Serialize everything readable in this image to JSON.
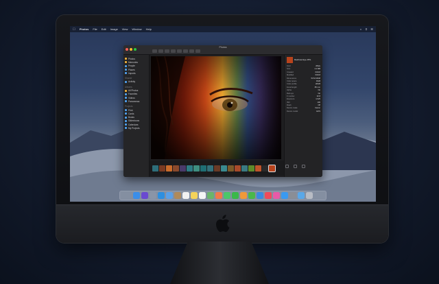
{
  "menubar": {
    "app": "Photos",
    "menus": [
      "File",
      "Edit",
      "Image",
      "View",
      "Window",
      "Help"
    ]
  },
  "window": {
    "title": "Photos"
  },
  "sidebar": {
    "items": [
      {
        "label": "Photos",
        "color": "#f0b23c"
      },
      {
        "label": "Memories",
        "color": "#f0b23c"
      },
      {
        "label": "People",
        "color": "#4ea0f0"
      },
      {
        "label": "Places",
        "color": "#4ea0f0"
      },
      {
        "label": "Imports",
        "color": "#4ea0f0"
      },
      {
        "label": "Shared",
        "section": true
      },
      {
        "label": "Activity",
        "color": "#4ea0f0"
      },
      {
        "label": "Albums",
        "section": true
      },
      {
        "label": "All Photos",
        "color": "#f0b23c"
      },
      {
        "label": "Favorites",
        "color": "#4ea0f0"
      },
      {
        "label": "Videos",
        "color": "#4ea0f0"
      },
      {
        "label": "Panoramas",
        "color": "#4ea0f0"
      },
      {
        "label": "Projects",
        "section": true
      },
      {
        "label": "Print",
        "color": "#4ea0f0"
      },
      {
        "label": "Cards",
        "color": "#4ea0f0"
      },
      {
        "label": "Books",
        "color": "#4ea0f0"
      },
      {
        "label": "Slideshows",
        "color": "#4ea0f0"
      },
      {
        "label": "Calendars",
        "color": "#4ea0f0"
      },
      {
        "label": "My Projects",
        "color": "#4ea0f0"
      }
    ]
  },
  "info_panel": {
    "name": "Rainbow Eye.JPG",
    "rows": [
      {
        "k": "Kind",
        "v": "JPEG"
      },
      {
        "k": "Size",
        "v": "4.2 MB"
      },
      {
        "k": "Created",
        "v": "6/4/18"
      },
      {
        "k": "Modified",
        "v": "6/4/18"
      },
      {
        "k": "Dimensions",
        "v": "5472×3648"
      },
      {
        "k": "Color space",
        "v": "RGB"
      },
      {
        "k": "Color profile",
        "v": "sRGB"
      },
      {
        "k": "Focal length",
        "v": "85 mm"
      },
      {
        "k": "Alpha",
        "v": "No"
      },
      {
        "k": "Red eye",
        "v": "No"
      },
      {
        "k": "F number",
        "v": "f/2.8"
      },
      {
        "k": "Exposure",
        "v": "1/125"
      },
      {
        "k": "ISO",
        "v": "100"
      },
      {
        "k": "Flash",
        "v": "Off"
      },
      {
        "k": "Device make",
        "v": "Canon"
      },
      {
        "k": "Device model",
        "v": "EOS"
      }
    ]
  },
  "filmstrip": {
    "thumbs": [
      "#2e6e7a",
      "#7a3a22",
      "#c96b2a",
      "#8a4a2c",
      "#4a3a6a",
      "#2d7c84",
      "#3e8e80",
      "#1f6e74",
      "#33707a",
      "#6a3a26",
      "#3a8a90",
      "#7a5a2a",
      "#a84a2a",
      "#3a7a82",
      "#5e8a2a",
      "#c0542a",
      "#2a2a2a",
      "#b8431c"
    ]
  },
  "dock": {
    "icons": [
      {
        "name": "finder-icon",
        "color": "#3b8ee8"
      },
      {
        "name": "siri-icon",
        "color": "#6a4ad0"
      },
      {
        "name": "launchpad-icon",
        "color": "#8a95a8"
      },
      {
        "name": "safari-icon",
        "color": "#2d8fe0"
      },
      {
        "name": "mail-icon",
        "color": "#5aa0e8"
      },
      {
        "name": "contacts-icon",
        "color": "#b08a5a"
      },
      {
        "name": "calendar-icon",
        "color": "#f2f2f2"
      },
      {
        "name": "notes-icon",
        "color": "#f4d35a"
      },
      {
        "name": "reminders-icon",
        "color": "#f5f5f5"
      },
      {
        "name": "maps-icon",
        "color": "#6ab56a"
      },
      {
        "name": "photos-icon",
        "color": "#f07a4a"
      },
      {
        "name": "messages-icon",
        "color": "#4cc66a"
      },
      {
        "name": "facetime-icon",
        "color": "#3ab84a"
      },
      {
        "name": "pages-icon",
        "color": "#f0993a"
      },
      {
        "name": "numbers-icon",
        "color": "#4ab84a"
      },
      {
        "name": "keynote-icon",
        "color": "#3a8ae0"
      },
      {
        "name": "news-icon",
        "color": "#f04a5a"
      },
      {
        "name": "itunes-icon",
        "color": "#e85aa8"
      },
      {
        "name": "app-store-icon",
        "color": "#3a9af0"
      },
      {
        "name": "system-preferences-icon",
        "color": "#8a8e96"
      },
      {
        "name": "folder-icon",
        "color": "#5aa8e8"
      },
      {
        "name": "trash-icon",
        "color": "#b8bcc4"
      }
    ]
  }
}
